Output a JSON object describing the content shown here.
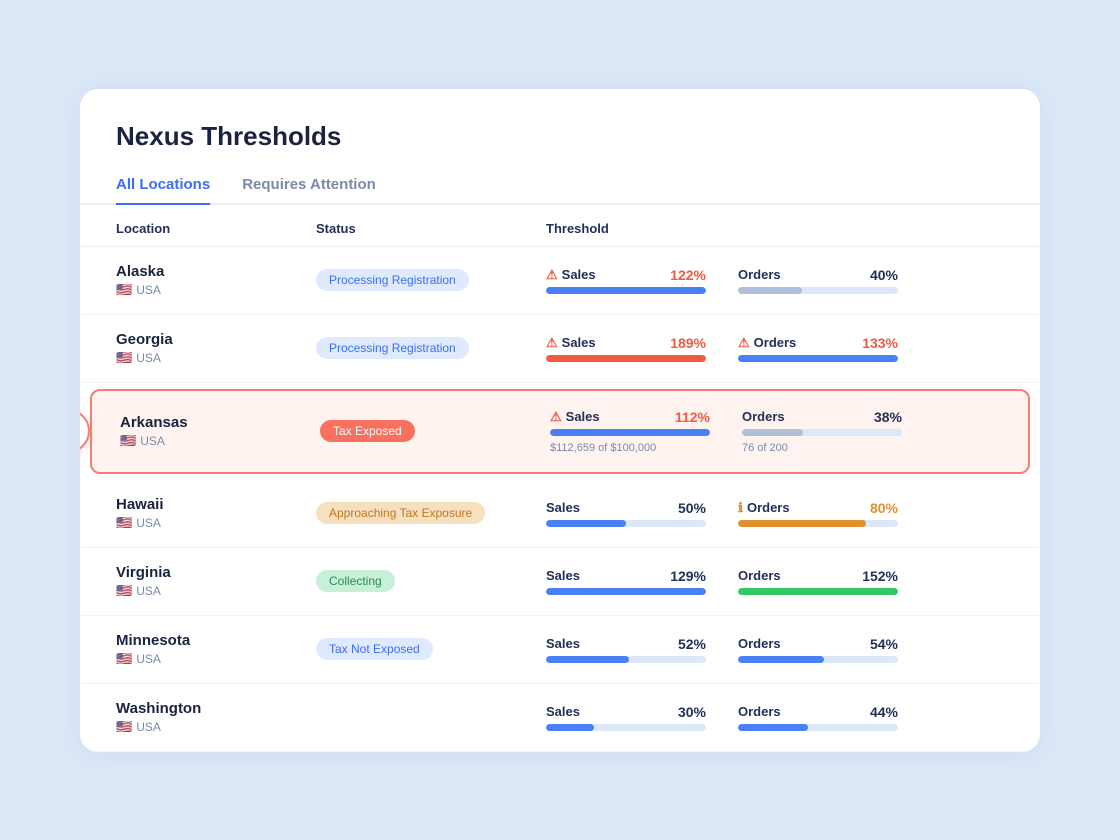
{
  "app": {
    "title": "Nexus Thresholds"
  },
  "tabs": [
    {
      "id": "all-locations",
      "label": "All Locations",
      "active": true
    },
    {
      "id": "requires-attention",
      "label": "Requires Attention",
      "active": false
    }
  ],
  "table": {
    "columns": [
      "Location",
      "Status",
      "Threshold"
    ],
    "rows": [
      {
        "id": "alaska",
        "name": "Alaska",
        "country": "USA",
        "flag": "🇺🇸",
        "status": "Processing Registration",
        "status_type": "processing",
        "highlighted": false,
        "sales_pct": 122,
        "sales_pct_label": "122%",
        "sales_pct_type": "warning",
        "sales_bar_pct": 100,
        "sales_bar_type": "blue",
        "sales_sub": "",
        "orders_pct": 40,
        "orders_pct_label": "40%",
        "orders_pct_type": "normal",
        "orders_bar_pct": 40,
        "orders_bar_type": "gray",
        "orders_sub": "",
        "sales_warn": true,
        "orders_warn": false,
        "orders_caution": false
      },
      {
        "id": "georgia",
        "name": "Georgia",
        "country": "USA",
        "flag": "🇺🇸",
        "status": "Processing Registration",
        "status_type": "processing",
        "highlighted": false,
        "sales_pct": 189,
        "sales_pct_label": "189%",
        "sales_pct_type": "warning",
        "sales_bar_pct": 100,
        "sales_bar_type": "red",
        "sales_sub": "",
        "orders_pct": 133,
        "orders_pct_label": "133%",
        "orders_pct_type": "warning",
        "orders_bar_pct": 100,
        "orders_bar_type": "blue",
        "orders_sub": "",
        "sales_warn": true,
        "orders_warn": true,
        "orders_caution": false
      },
      {
        "id": "arkansas",
        "name": "Arkansas",
        "country": "USA",
        "flag": "🇺🇸",
        "status": "Tax Exposed",
        "status_type": "tax-exposed",
        "highlighted": true,
        "sales_pct": 112,
        "sales_pct_label": "112%",
        "sales_pct_type": "warning",
        "sales_bar_pct": 100,
        "sales_bar_type": "blue",
        "sales_sub": "$112,659 of $100,000",
        "orders_pct": 38,
        "orders_pct_label": "38%",
        "orders_pct_type": "normal",
        "orders_bar_pct": 38,
        "orders_bar_type": "gray",
        "orders_sub": "76 of 200",
        "sales_warn": true,
        "orders_warn": false,
        "orders_caution": false
      },
      {
        "id": "hawaii",
        "name": "Hawaii",
        "country": "USA",
        "flag": "🇺🇸",
        "status": "Approaching Tax Exposure",
        "status_type": "approaching",
        "highlighted": false,
        "sales_pct": 50,
        "sales_pct_label": "50%",
        "sales_pct_type": "normal",
        "sales_bar_pct": 50,
        "sales_bar_type": "blue",
        "sales_sub": "",
        "orders_pct": 80,
        "orders_pct_label": "80%",
        "orders_pct_type": "caution",
        "orders_bar_pct": 80,
        "orders_bar_type": "orange",
        "orders_sub": "",
        "sales_warn": false,
        "orders_warn": false,
        "orders_caution": true
      },
      {
        "id": "virginia",
        "name": "Virginia",
        "country": "USA",
        "flag": "🇺🇸",
        "status": "Collecting",
        "status_type": "collecting",
        "highlighted": false,
        "sales_pct": 129,
        "sales_pct_label": "129%",
        "sales_pct_type": "normal",
        "sales_bar_pct": 100,
        "sales_bar_type": "blue",
        "sales_sub": "",
        "orders_pct": 152,
        "orders_pct_label": "152%",
        "orders_pct_type": "normal",
        "orders_bar_pct": 100,
        "orders_bar_type": "green",
        "orders_sub": "",
        "sales_warn": false,
        "orders_warn": false,
        "orders_caution": false
      },
      {
        "id": "minnesota",
        "name": "Minnesota",
        "country": "USA",
        "flag": "🇺🇸",
        "status": "Tax Not Exposed",
        "status_type": "not-exposed",
        "highlighted": false,
        "sales_pct": 52,
        "sales_pct_label": "52%",
        "sales_pct_type": "normal",
        "sales_bar_pct": 52,
        "sales_bar_type": "blue",
        "sales_sub": "",
        "orders_pct": 54,
        "orders_pct_label": "54%",
        "orders_pct_type": "normal",
        "orders_bar_pct": 54,
        "orders_bar_type": "blue",
        "orders_sub": "",
        "sales_warn": false,
        "orders_warn": false,
        "orders_caution": false
      },
      {
        "id": "washington",
        "name": "Washington",
        "country": "USA",
        "flag": "🇺🇸",
        "status": "",
        "status_type": "processing",
        "highlighted": false,
        "sales_pct": 30,
        "sales_pct_label": "30%",
        "sales_pct_type": "normal",
        "sales_bar_pct": 30,
        "sales_bar_type": "blue",
        "sales_sub": "",
        "orders_pct": 44,
        "orders_pct_label": "44%",
        "orders_pct_type": "normal",
        "orders_bar_pct": 44,
        "orders_bar_type": "blue",
        "orders_sub": "",
        "sales_warn": false,
        "orders_warn": false,
        "orders_caution": false
      }
    ]
  }
}
